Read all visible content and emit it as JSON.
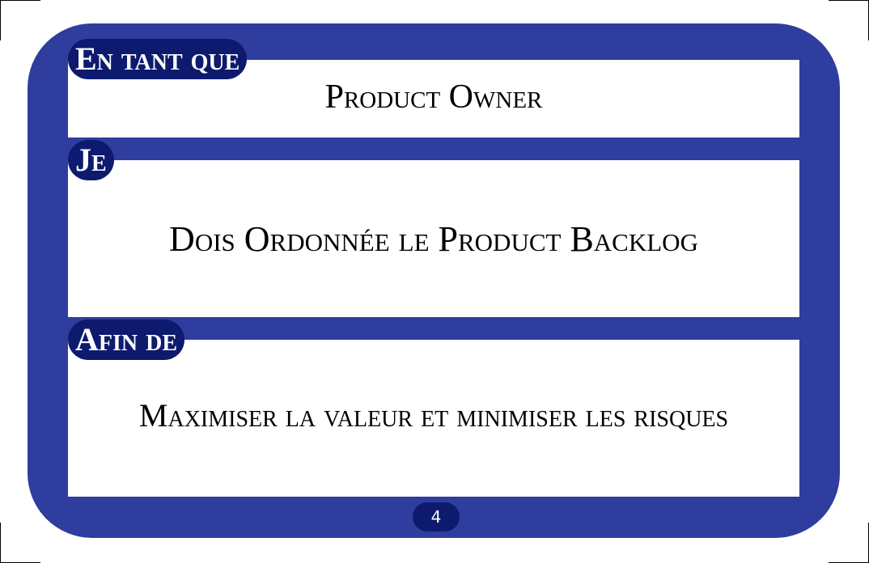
{
  "card": {
    "role_label": "En tant que",
    "role_value": "Product Owner",
    "action_label": "Je",
    "action_value": "Dois Ordonnée le Product Backlog",
    "goal_label": "Afin de",
    "goal_value": "Maximiser la valeur et minimiser les risques",
    "page_number": "4"
  },
  "colors": {
    "card_border": "#2f3d9e",
    "label_background": "#0d1a6e",
    "panel_background": "#ffffff"
  }
}
